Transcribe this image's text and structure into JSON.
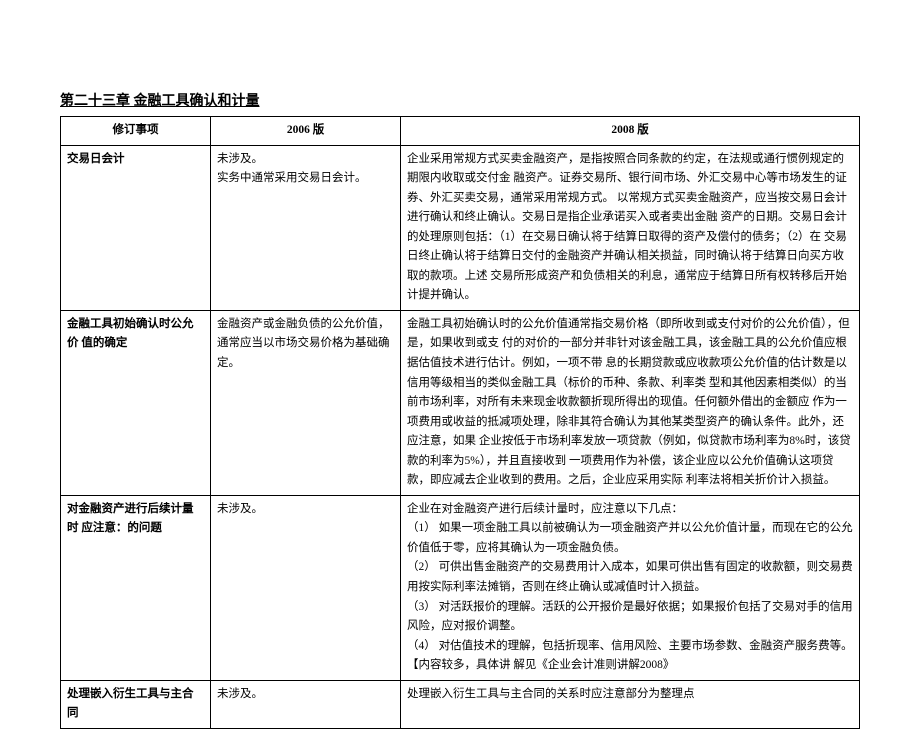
{
  "heading": "第二十三章  金融工具确认和计量",
  "headers": {
    "col1": "修订事项",
    "col2": "2006 版",
    "col3": "2008 版"
  },
  "rows": [
    {
      "item": "交易日会计",
      "v2006": "未涉及。\n实务中通常采用交易日会计。",
      "v2008": "企业采用常规方式买卖金融资产，是指按照合同条款的约定，在法规或通行惯例规定的期限内收取或交付金 融资产。证券交易所、银行间市场、外汇交易中心等市场发生的证券、外汇买卖交易，通常采用常规方式。 以常规方式买卖金融资产，应当按交易日会计进行确认和终止确认。交易日是指企业承诺买入或者卖出金融 资产的日期。交易日会计的处理原则包括：（1）在交易日确认将于结算日取得的资产及偿付的债务；（2）在 交易日终止确认将于结算日交付的金融资产并确认相关损益，同时确认将于结算日向买方收取的款项。上述 交易所形成资产和负债相关的利息，通常应于结算日所有权转移后开始计提并确认。"
    },
    {
      "item": "金融工具初始确认时公允价 值的确定",
      "v2006": "金融资产或金融负债的公允价值，通常应当以市场交易价格为基础确定。",
      "v2008": "金融工具初始确认时的公允价值通常指交易价格（即所收到或支付对价的公允价值），但是，如果收到或支 付的对价的一部分并非针对该金融工具，该金融工具的公允价值应根据估值技术进行估计。例如，一项不带 息的长期贷款或应收款项公允价值的估计数是以信用等级相当的类似金融工具（标价的币种、条款、利率类 型和其他因素相类似）的当前市场利率，对所有未来现金收款额折现所得出的现值。任何额外借出的金额应 作为一项费用或收益的抵减项处理，除非其符合确认为其他某类型资产的确认条件。此外，还应注意，如果 企业按低于市场利率发放一项贷款（例如，似贷款市场利率为8%时，该贷款的利率为5%），并且直接收到 一项费用作为补偿，该企业应以公允价值确认这项贷款，即应减去企业收到的费用。之后，企业应采用实际 利率法将相关折价计入损益。"
    },
    {
      "item": "对金融资产进行后续计量时 应注意：的问题",
      "v2006": "未涉及。",
      "v2008": "     企业在对金融资产进行后续计量时，应注意以下几点：\n（1）      如果一项金融工具以前被确认为一项金融资产并以公允价值计量，而现在它的公允价值低于零，应将其确认为一项金融负债。\n（2）      可供出售金融资产的交易费用计入成本，如果可供出售有固定的收款额，则交易费用按实际利率法摊销，否则在终止确认或减值时计入损益。\n（3）      对活跃报价的理解。活跃的公开报价是最好依据；如果报价包括了交易对手的信用风险，应对报价调整。\n（4）      对估值技术的理解，包括折现率、信用风险、主要市场参数、金融资产服务费等。【内容较多，具体讲 解见《企业会计准则讲解2008》"
    },
    {
      "item": "处理嵌入衍生工具与主合同",
      "v2006": "未涉及。",
      "v2008": "处理嵌入衍生工具与主合同的关系时应注意部分为整理点"
    }
  ]
}
